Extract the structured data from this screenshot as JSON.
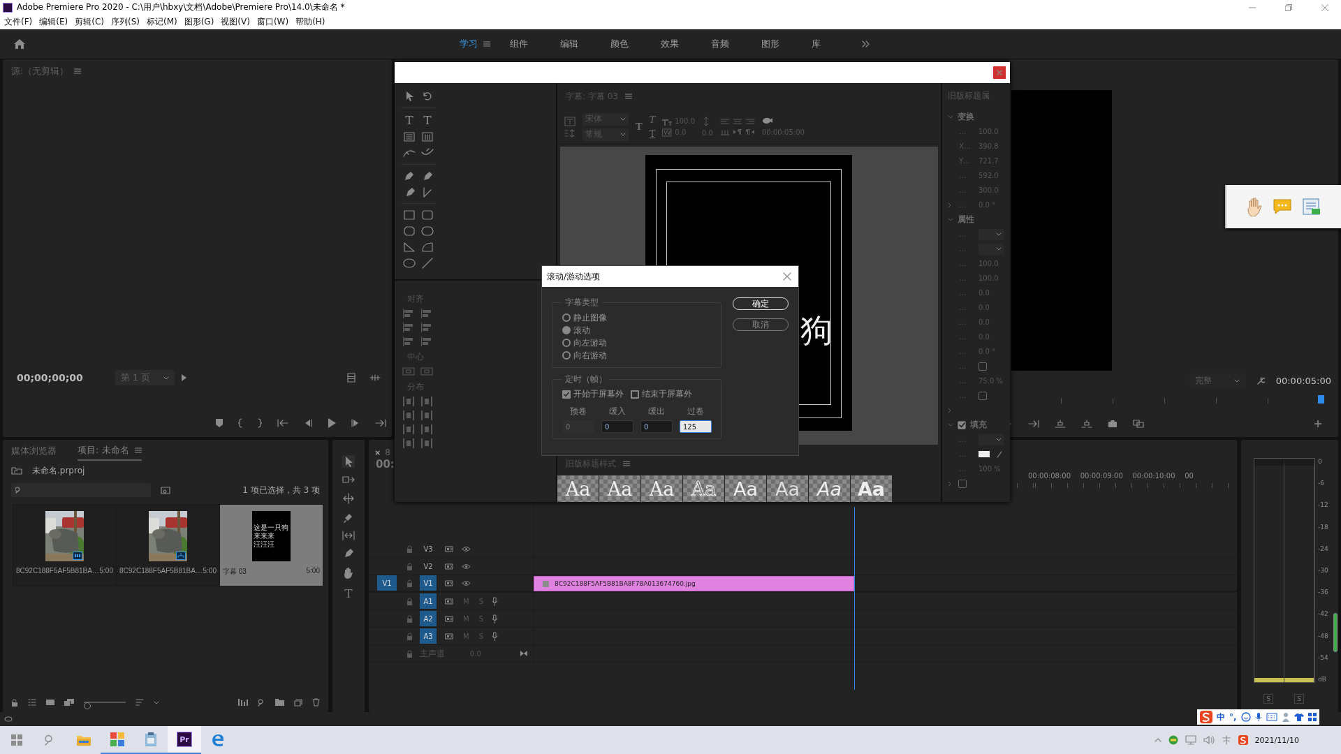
{
  "window": {
    "title": "Adobe Premiere Pro 2020 - C:\\用户\\hbxy\\文档\\Adobe\\Premiere Pro\\14.0\\未命名 *"
  },
  "menu": [
    "文件(F)",
    "编辑(E)",
    "剪辑(C)",
    "序列(S)",
    "标记(M)",
    "图形(G)",
    "视图(V)",
    "窗口(W)",
    "帮助(H)"
  ],
  "workspaces": [
    {
      "label": "学习",
      "selected": true
    },
    {
      "label": "组件",
      "selected": false
    },
    {
      "label": "编辑",
      "selected": false
    },
    {
      "label": "颜色",
      "selected": false
    },
    {
      "label": "效果",
      "selected": false
    },
    {
      "label": "音频",
      "selected": false
    },
    {
      "label": "图形",
      "selected": false
    },
    {
      "label": "库",
      "selected": false
    }
  ],
  "source_monitor": {
    "title": "源:（无剪辑）",
    "timecode": "00;00;00;00",
    "page": "第 1 页"
  },
  "program_monitor": {
    "zoom": "完整",
    "timecode": "00:00:05:00"
  },
  "project": {
    "tabs": [
      {
        "label": "媒体浏览器",
        "selected": false
      },
      {
        "label": "项目: 未命名",
        "selected": true
      }
    ],
    "file": "未命名.prproj",
    "selection": "1 项已选择，共 3 项",
    "zoom": {
      "level": 0
    },
    "items": [
      {
        "kind": "clip",
        "name": "8C92C188F5AF5B81BA…",
        "duration": "5:00",
        "selected": false
      },
      {
        "kind": "sequence",
        "name": "8C92C188F5AF5B81BA…",
        "duration": "5:00",
        "selected": false
      },
      {
        "kind": "title",
        "name": "字幕 03",
        "duration": "5:00",
        "selected": true,
        "preview": [
          "这是一只狗",
          "来来来",
          "汪汪汪"
        ]
      }
    ]
  },
  "tools": {
    "type_tool": "T"
  },
  "timeline": {
    "close": "×",
    "tab": "8",
    "timecode": "00:",
    "ruler": [
      "00:00:08:00",
      "00:00:09:00",
      "00:00:10:00",
      "00"
    ],
    "tracks": [
      {
        "kind": "video",
        "name": "V3",
        "targeted": false
      },
      {
        "kind": "video",
        "name": "V2",
        "targeted": false
      },
      {
        "kind": "video",
        "name": "V1",
        "targeted": true,
        "source": "V1"
      },
      {
        "kind": "audio",
        "name": "A1",
        "targeted": true,
        "mute": "M",
        "solo": "S"
      },
      {
        "kind": "audio",
        "name": "A2",
        "targeted": true,
        "mute": "M",
        "solo": "S"
      },
      {
        "kind": "audio",
        "name": "A3",
        "targeted": true,
        "mute": "M",
        "solo": "S"
      }
    ],
    "master": {
      "name": "主声道",
      "volume": "0.0"
    },
    "clip": {
      "name": "8C92C188F5AF5B81BA8F78A013674760.jpg"
    }
  },
  "audio_meter": {
    "scale": [
      "0",
      "-6",
      "-12",
      "-18",
      "-24",
      "-30",
      "-36",
      "-42",
      "-48",
      "-54",
      "dB"
    ],
    "solo": [
      "S",
      "S"
    ]
  },
  "titler": {
    "title": "字幕: 字幕 03",
    "type_tools": [
      "T",
      "T"
    ],
    "font_family": "宋体",
    "font_style": "常规",
    "style_buttons": [
      {
        "label": "T",
        "kind": "bold"
      },
      {
        "label": "T",
        "kind": "italic"
      },
      {
        "label": "T",
        "kind": "underline"
      }
    ],
    "font_size": "100.0",
    "kerning": "0.0",
    "leading": "0.0",
    "timecode": "00:00:05:00",
    "canvas_text": "狗",
    "align": "对齐",
    "center": "中心",
    "distribute": "分布",
    "styles": {
      "title": "旧版标题样式",
      "swatches": [
        {
          "label": "Aa",
          "kind": "serif"
        },
        {
          "label": "Aa",
          "kind": "serif"
        },
        {
          "label": "Aa",
          "kind": "serif"
        },
        {
          "label": "Aa",
          "kind": "outline"
        },
        {
          "label": "Aa",
          "kind": "sans"
        },
        {
          "label": "Aa",
          "kind": "light"
        },
        {
          "label": "Aa",
          "kind": "italic"
        },
        {
          "label": "Aa",
          "kind": "bold"
        }
      ]
    },
    "properties": {
      "title": "旧版标题属",
      "sections": [
        {
          "label": "变换",
          "kind": "plain",
          "rows": [
            {
              "kind": "value",
              "label": "…",
              "value": "100.0"
            },
            {
              "kind": "value",
              "label": "X…",
              "value": "390.8"
            },
            {
              "kind": "value",
              "label": "Y…",
              "value": "721.7"
            },
            {
              "kind": "value",
              "label": "…",
              "value": "592.0"
            },
            {
              "kind": "value",
              "label": "…",
              "value": "300.0"
            },
            {
              "kind": "subgroup",
              "label": "…",
              "value": "0.0 °"
            }
          ]
        },
        {
          "label": "属性",
          "kind": "plain",
          "rows": [
            {
              "kind": "dropdown",
              "label": "…"
            },
            {
              "kind": "dropdown",
              "label": "…"
            },
            {
              "kind": "value",
              "label": "…",
              "value": "100.0"
            },
            {
              "kind": "value",
              "label": "…",
              "value": "100.0"
            },
            {
              "kind": "value",
              "label": "…",
              "value": "0.0"
            },
            {
              "kind": "value",
              "label": "…",
              "value": "0.0"
            },
            {
              "kind": "value",
              "label": "…",
              "value": "0.0"
            },
            {
              "kind": "value",
              "label": "…",
              "value": "0.0"
            },
            {
              "kind": "value",
              "label": "…",
              "value": "0.0 °"
            },
            {
              "kind": "checkbox",
              "label": "…",
              "checked": false
            },
            {
              "kind": "value",
              "label": "…",
              "value": "75.0 %"
            },
            {
              "kind": "checkbox",
              "label": "…",
              "checked": false
            },
            {
              "kind": "more"
            }
          ]
        },
        {
          "label": "填充",
          "kind": "checkbox",
          "checked": true,
          "rows": [
            {
              "kind": "dropdown",
              "label": "…"
            },
            {
              "kind": "swatch",
              "label": "…"
            },
            {
              "kind": "value",
              "label": "…",
              "value": "100 %"
            },
            {
              "kind": "subcheck",
              "checked": false
            }
          ]
        }
      ]
    }
  },
  "dialog": {
    "title": "滚动/游动选项",
    "type_group": "字幕类型",
    "types": [
      {
        "label": "静止图像",
        "selected": false
      },
      {
        "label": "滚动",
        "selected": true
      },
      {
        "label": "向左游动",
        "selected": false
      },
      {
        "label": "向右游动",
        "selected": false
      }
    ],
    "timing_group": "定时（帧）",
    "options": [
      {
        "label": "开始于屏幕外",
        "checked": true
      },
      {
        "label": "结束于屏幕外",
        "checked": false
      }
    ],
    "fields": [
      {
        "label": "预卷",
        "value": "0",
        "disabled": true,
        "focused": false
      },
      {
        "label": "缓入",
        "value": "0",
        "disabled": false,
        "focused": false
      },
      {
        "label": "缓出",
        "value": "0",
        "disabled": false,
        "focused": false
      },
      {
        "label": "过卷",
        "value": "125",
        "disabled": false,
        "focused": true
      }
    ],
    "buttons": [
      {
        "label": "确定",
        "kind": "default"
      },
      {
        "label": "取消",
        "kind": "normal"
      }
    ]
  },
  "ime": {
    "mode": "中",
    "punctuation": "°,"
  },
  "taskbar": {
    "apps": [
      {
        "kind": "folder",
        "running": false,
        "selected": false
      },
      {
        "kind": "tiles",
        "running": true,
        "selected": false
      },
      {
        "kind": "clipboard",
        "running": true,
        "selected": false
      },
      {
        "kind": "premiere",
        "label": "Pr",
        "running": true,
        "selected": true
      },
      {
        "kind": "browser",
        "running": false,
        "selected": false
      }
    ],
    "date": "2021/11/10"
  }
}
